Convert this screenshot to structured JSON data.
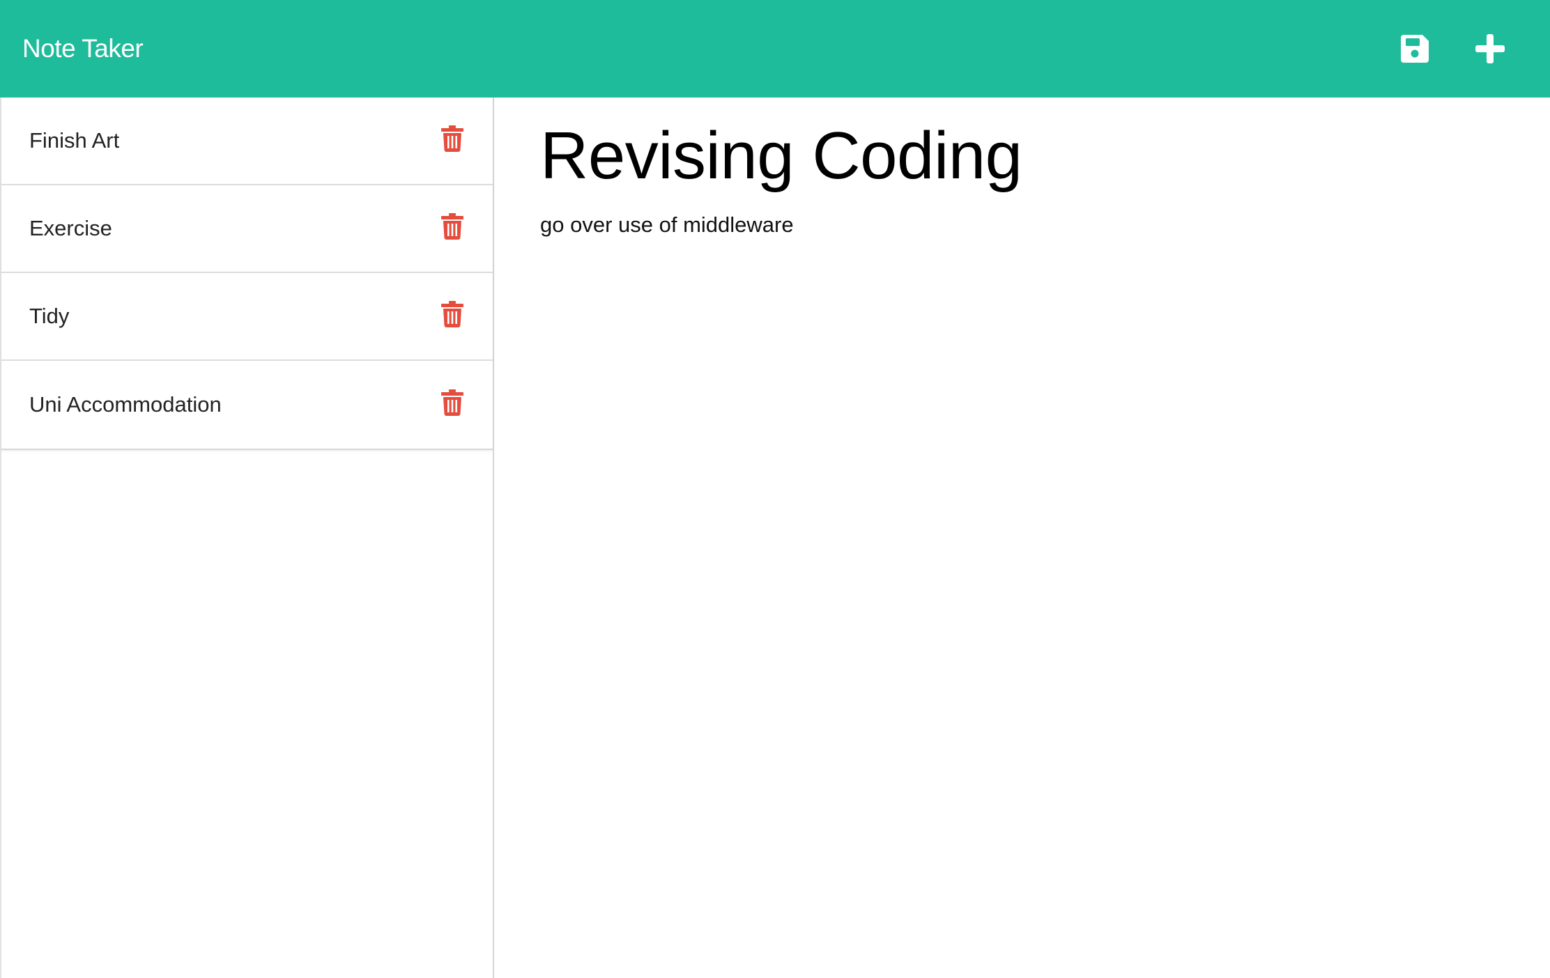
{
  "app": {
    "title": "Note Taker",
    "accent_color": "#1ebc9b",
    "delete_color": "#e64c3c"
  },
  "toolbar": {
    "save_icon": "floppy-disk-icon",
    "new_icon": "plus-icon"
  },
  "sidebar": {
    "notes": [
      {
        "title": "Finish Art",
        "icon": "trash-icon"
      },
      {
        "title": "Exercise",
        "icon": "trash-icon"
      },
      {
        "title": "Tidy",
        "icon": "trash-icon"
      },
      {
        "title": "Uni Accommodation",
        "icon": "trash-icon"
      }
    ]
  },
  "editor": {
    "title": "Revising Coding",
    "body": "go over use of middleware"
  }
}
